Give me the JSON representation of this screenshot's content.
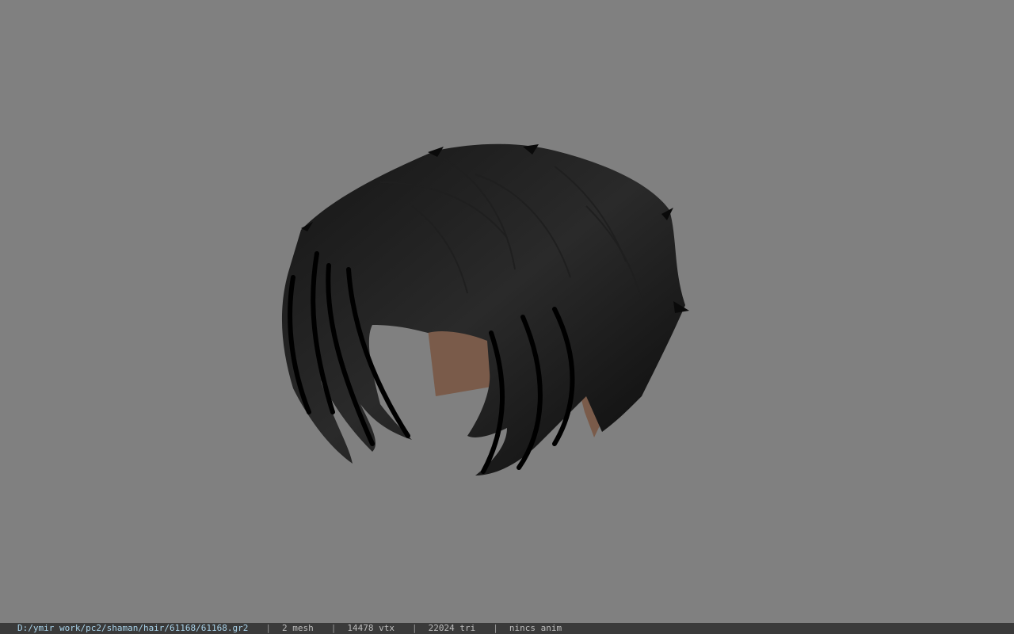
{
  "viewport": {
    "background": "#808080",
    "model": {
      "icon": "hair-mesh-icon",
      "hair_color": "#0b0b0b",
      "skin_color": "#7a5b4a"
    }
  },
  "statusbar": {
    "file_path": "D:/ymir work/pc2/shaman/hair/61168/61168.gr2",
    "separator": "|",
    "mesh_count": "2 mesh",
    "vertex_count": "14478 vtx",
    "triangle_count": "22024 tri",
    "anim_status": "nincs anim"
  }
}
